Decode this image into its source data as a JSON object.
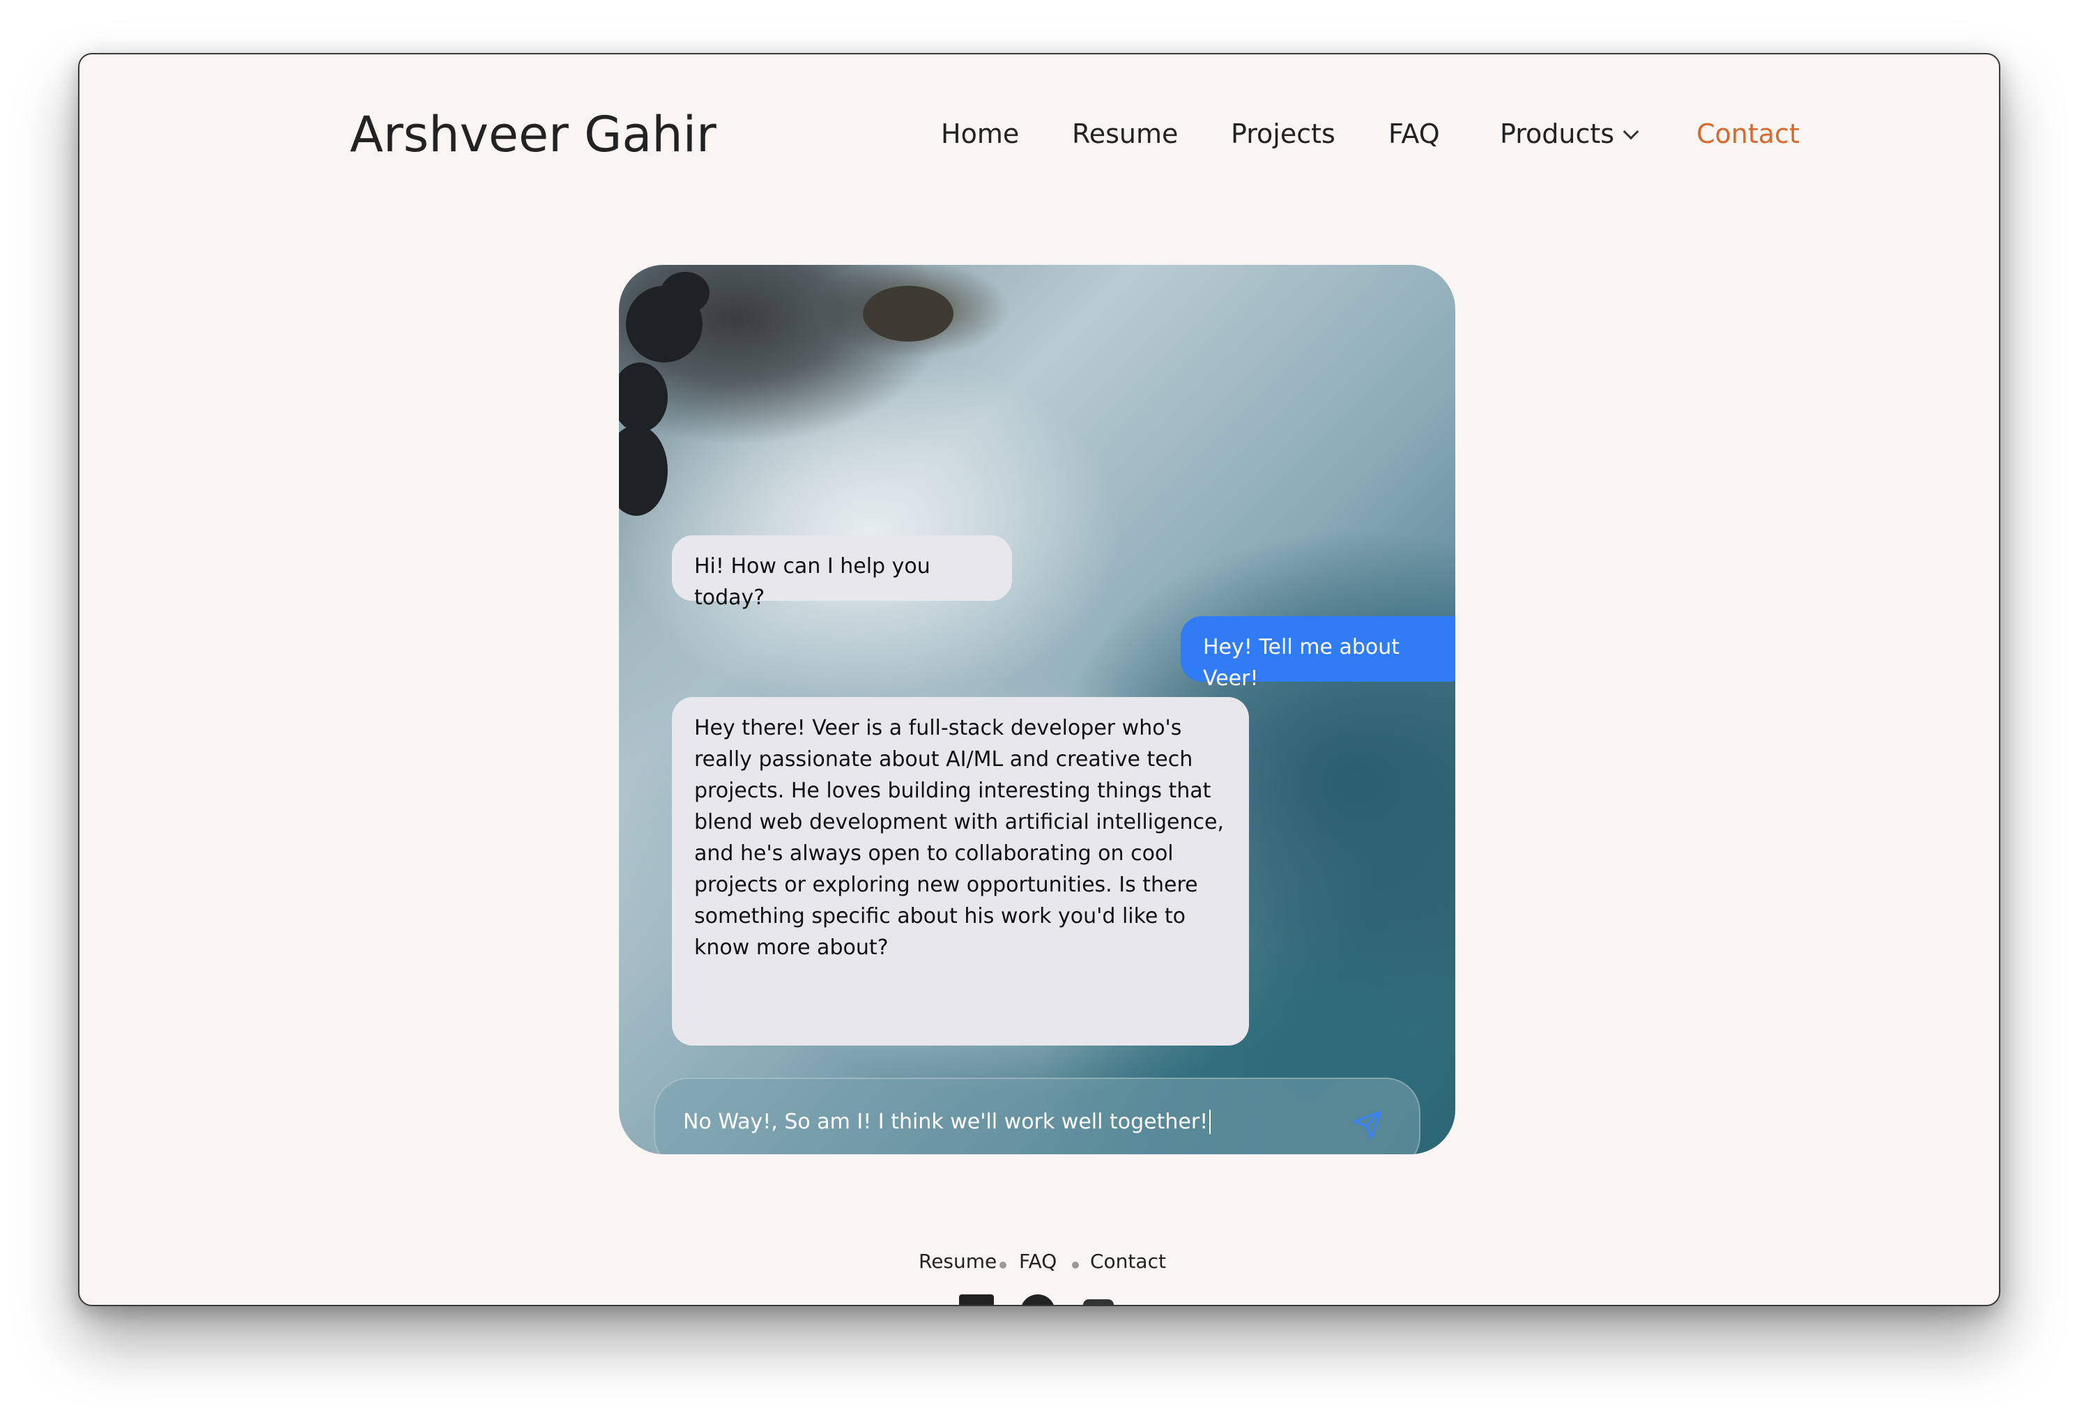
{
  "site": {
    "title": "Arshveer Gahir"
  },
  "nav": {
    "items": [
      {
        "label": "Home"
      },
      {
        "label": "Resume"
      },
      {
        "label": "Projects"
      },
      {
        "label": "FAQ"
      },
      {
        "label": "Products"
      },
      {
        "label": "Contact"
      }
    ],
    "active": "Contact",
    "accent_color": "#d7692d"
  },
  "chat": {
    "messages": [
      {
        "role": "assistant",
        "text": "Hi! How can I help you today?"
      },
      {
        "role": "user",
        "text": "Hey! Tell me about Veer!"
      },
      {
        "role": "assistant",
        "text": "Hey there! Veer is a full-stack developer who's really passionate about AI/ML and creative tech projects. He loves building interesting things that blend web development with artificial intelligence, and he's always open to collaborating on cool projects or exploring new opportunities. Is there something specific about his work you'd like to know more about?"
      }
    ],
    "input_value": "No Way!, So am I! I think we'll work well together!",
    "send_icon": "send-icon",
    "user_bubble_color": "#2f7cf6",
    "bot_bubble_color": "#e8e7ec"
  },
  "footer": {
    "links": [
      {
        "label": "Resume"
      },
      {
        "label": "FAQ"
      },
      {
        "label": "Contact"
      }
    ],
    "social_icons": [
      "linkedin-icon",
      "github-icon",
      "x-icon"
    ]
  }
}
